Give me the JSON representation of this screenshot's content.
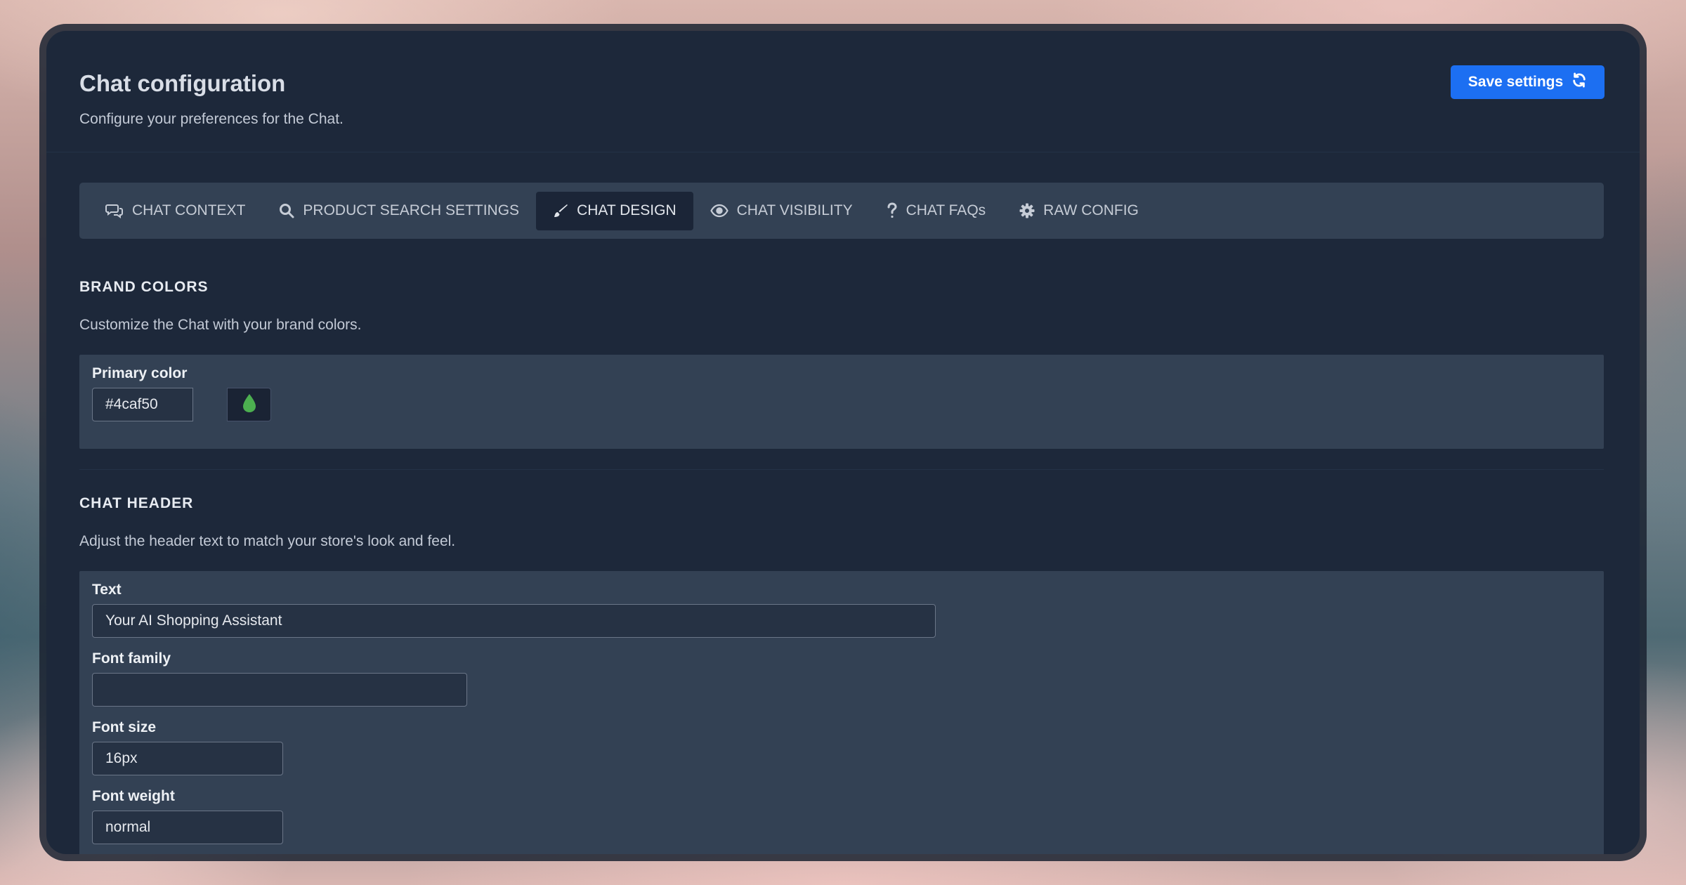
{
  "header": {
    "title": "Chat configuration",
    "subtitle": "Configure your preferences for the Chat.",
    "save_label": "Save settings"
  },
  "tabs": [
    {
      "label": "CHAT CONTEXT",
      "icon": "chat-bubbles-icon",
      "active": false
    },
    {
      "label": "PRODUCT SEARCH SETTINGS",
      "icon": "search-icon",
      "active": false
    },
    {
      "label": "CHAT DESIGN",
      "icon": "paintbrush-icon",
      "active": true
    },
    {
      "label": "CHAT VISIBILITY",
      "icon": "eye-icon",
      "active": false
    },
    {
      "label": "CHAT FAQs",
      "icon": "question-icon",
      "active": false
    },
    {
      "label": "RAW CONFIG",
      "icon": "gear-icon",
      "active": false
    }
  ],
  "brand_colors": {
    "title": "BRAND COLORS",
    "description": "Customize the Chat with your brand colors.",
    "primary_color_label": "Primary color",
    "primary_color_value": "#4caf50",
    "swatch_color": "#4caf50"
  },
  "chat_header": {
    "title": "CHAT HEADER",
    "description": "Adjust the header text to match your store's look and feel.",
    "text_label": "Text",
    "text_value": "Your AI Shopping Assistant",
    "font_family_label": "Font family",
    "font_family_value": "",
    "font_size_label": "Font size",
    "font_size_value": "16px",
    "font_weight_label": "Font weight",
    "font_weight_value": "normal"
  },
  "colors": {
    "accent": "#1c6ff2",
    "panel": "#1d283a",
    "card": "#334154"
  }
}
